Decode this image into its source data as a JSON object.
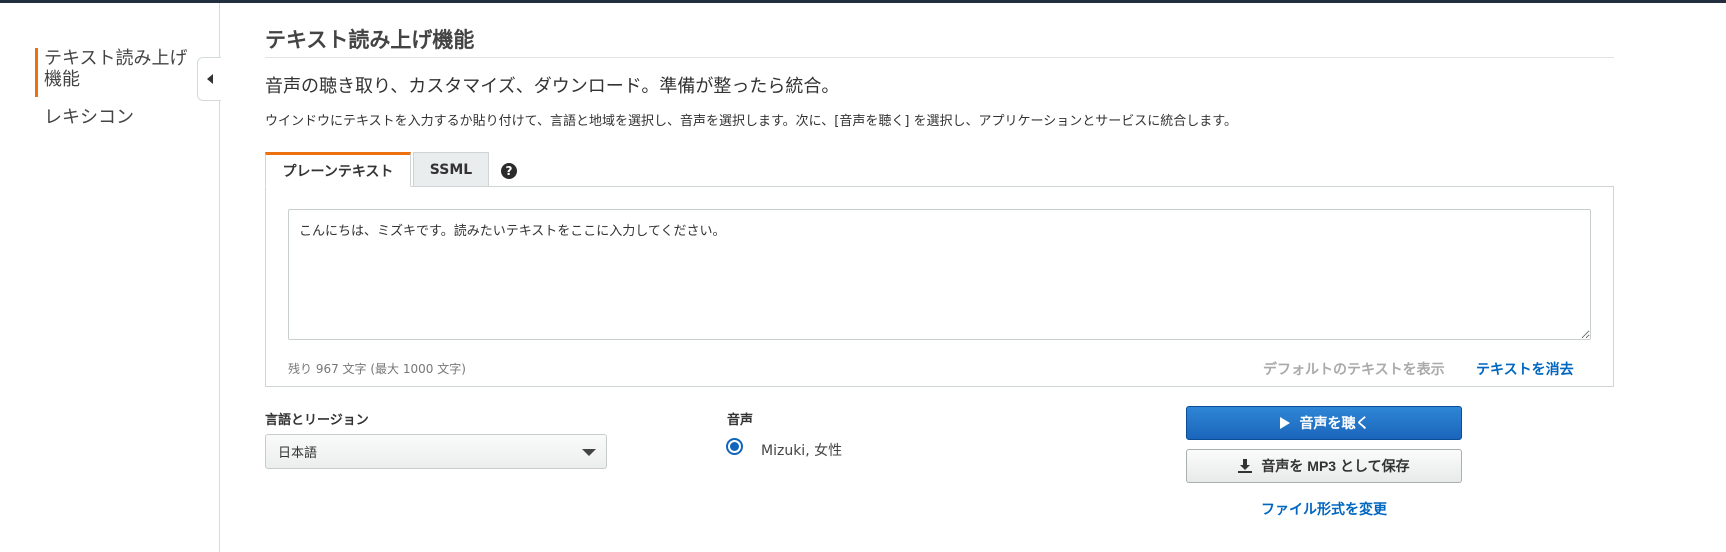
{
  "sidebar": {
    "items": [
      {
        "label": "テキスト読み上げ機能"
      },
      {
        "label": "レキシコン"
      }
    ]
  },
  "main": {
    "title": "テキスト読み上げ機能",
    "subtitle": "音声の聴き取り、カスタマイズ、ダウンロード。準備が整ったら統合。",
    "description": "ウインドウにテキストを入力するか貼り付けて、言語と地域を選択し、音声を選択します。次に、[音声を聴く] を選択し、アプリケーションとサービスに統合します。",
    "tabs": [
      {
        "label": "プレーンテキスト",
        "active": true
      },
      {
        "label": "SSML",
        "active": false
      }
    ],
    "help_symbol": "?",
    "text_input": {
      "value": "こんにちは、ミズキです。読みたいテキストをここに入力してください。"
    },
    "char_count": "残り 967 文字 (最大 1000 文字)",
    "default_text_link": "デフォルトのテキストを表示",
    "clear_text_link": "テキストを消去",
    "language": {
      "label": "言語とリージョン",
      "selected": "日本語"
    },
    "voice": {
      "label": "音声",
      "selected": "Mizuki, 女性"
    },
    "buttons": {
      "play": "音声を聴く",
      "save": "音声を MP3 として保存",
      "change_format": "ファイル形式を変更"
    }
  },
  "colors": {
    "accent": "#ec7211",
    "primary": "#1a65bb",
    "link": "#0066c0"
  },
  "icons": [
    "chevron-left-icon",
    "help-icon",
    "play-icon",
    "download-icon",
    "caret-down-icon"
  ]
}
